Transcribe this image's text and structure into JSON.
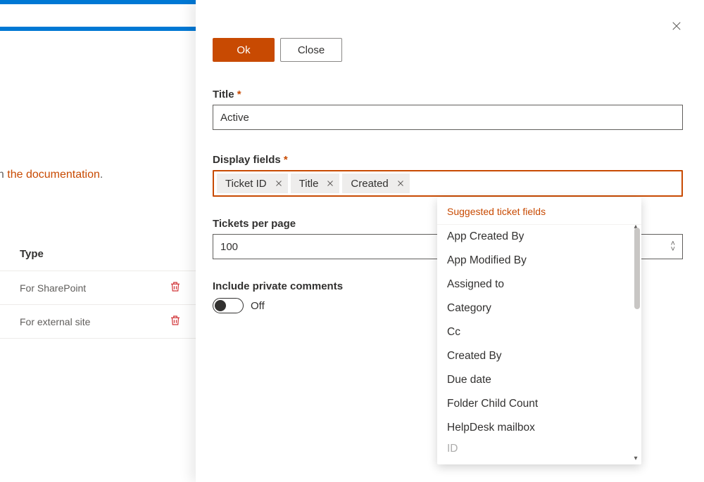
{
  "background": {
    "doc_prefix": "n in ",
    "doc_link": "the documentation",
    "doc_suffix": ".",
    "type_header": "Type",
    "rows": [
      {
        "label": "For SharePoint"
      },
      {
        "label": "For external site"
      }
    ]
  },
  "panel": {
    "ok_label": "Ok",
    "close_label": "Close",
    "title_label": "Title",
    "title_value": "Active",
    "display_fields_label": "Display fields",
    "tags": [
      {
        "label": "Ticket ID"
      },
      {
        "label": "Title"
      },
      {
        "label": "Created"
      }
    ],
    "per_page_label": "Tickets per page",
    "per_page_value": "100",
    "include_label": "Include private comments",
    "toggle_state": "Off"
  },
  "suggest": {
    "header": "Suggested ticket fields",
    "items": [
      "App Created By",
      "App Modified By",
      "Assigned to",
      "Category",
      "Cc",
      "Created By",
      "Due date",
      "Folder Child Count",
      "HelpDesk mailbox",
      "ID"
    ]
  }
}
